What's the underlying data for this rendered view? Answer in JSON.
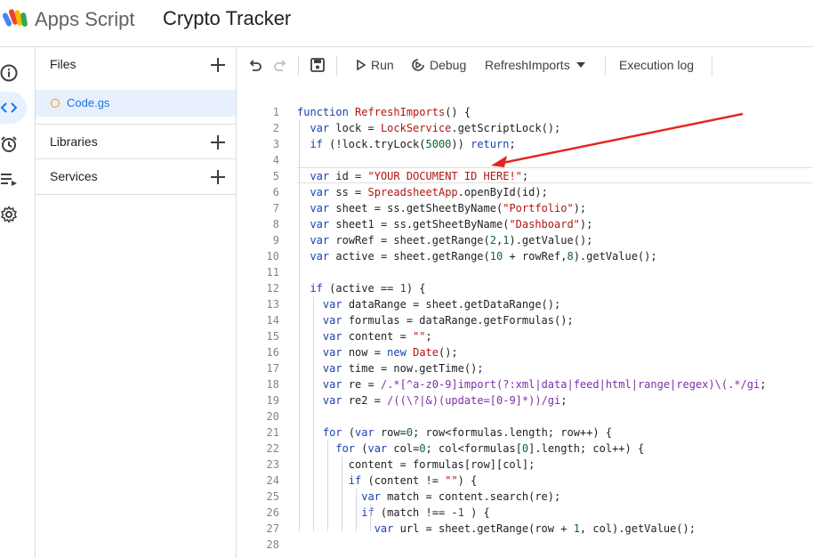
{
  "header": {
    "app_name": "Apps Script",
    "project_title": "Crypto Tracker"
  },
  "rail": {
    "items": [
      "overview-icon",
      "editor-icon",
      "triggers-icon",
      "executions-icon",
      "settings-icon"
    ]
  },
  "files_panel": {
    "files_label": "Files",
    "files": [
      {
        "name": "Code.gs"
      }
    ],
    "libraries_label": "Libraries",
    "services_label": "Services"
  },
  "toolbar": {
    "run_label": "Run",
    "debug_label": "Debug",
    "function_select": "RefreshImports",
    "execution_log_label": "Execution log"
  },
  "editor": {
    "line_numbers": [
      "1",
      "2",
      "3",
      "4",
      "5",
      "6",
      "7",
      "8",
      "9",
      "10",
      "11",
      "12",
      "13",
      "14",
      "15",
      "16",
      "17",
      "18",
      "19",
      "20",
      "21",
      "22",
      "23",
      "24",
      "25",
      "26",
      "27",
      "28"
    ],
    "lines": [
      "function RefreshImports() {",
      "  var lock = LockService.getScriptLock();",
      "  if (!lock.tryLock(5000)) return;",
      "",
      "  var id = \"YOUR DOCUMENT ID HERE!\";",
      "  var ss = SpreadsheetApp.openById(id);",
      "  var sheet = ss.getSheetByName(\"Portfolio\");",
      "  var sheet1 = ss.getSheetByName(\"Dashboard\");",
      "  var rowRef = sheet.getRange(2,1).getValue();",
      "  var active = sheet.getRange(10 + rowRef,8).getValue();",
      "",
      "  if (active == 1) {",
      "    var dataRange = sheet.getDataRange();",
      "    var formulas = dataRange.getFormulas();",
      "    var content = \"\";",
      "    var now = new Date();",
      "    var time = now.getTime();",
      "    var re = /.*[^a-z0-9]import(?:xml|data|feed|html|range|regex)\\(.*/gi;",
      "    var re2 = /((\\?|&)(update=[0-9]*))/gi;",
      "",
      "    for (var row=0; row<formulas.length; row++) {",
      "      for (var col=0; col<formulas[0].length; col++) {",
      "        content = formulas[row][col];",
      "        if (content != \"\") {",
      "          var match = content.search(re);",
      "          if (match !== -1 ) {",
      "            var url = sheet.getRange(row + 1, col).getValue();",
      ""
    ]
  },
  "colors": {
    "accent": "#1a73e8",
    "keyword": "#1a3fb0",
    "string": "#b31412",
    "number": "#0d652d",
    "regex": "#7b2fa6",
    "arrow": "#e5261f",
    "file_dot": "#f29900"
  }
}
